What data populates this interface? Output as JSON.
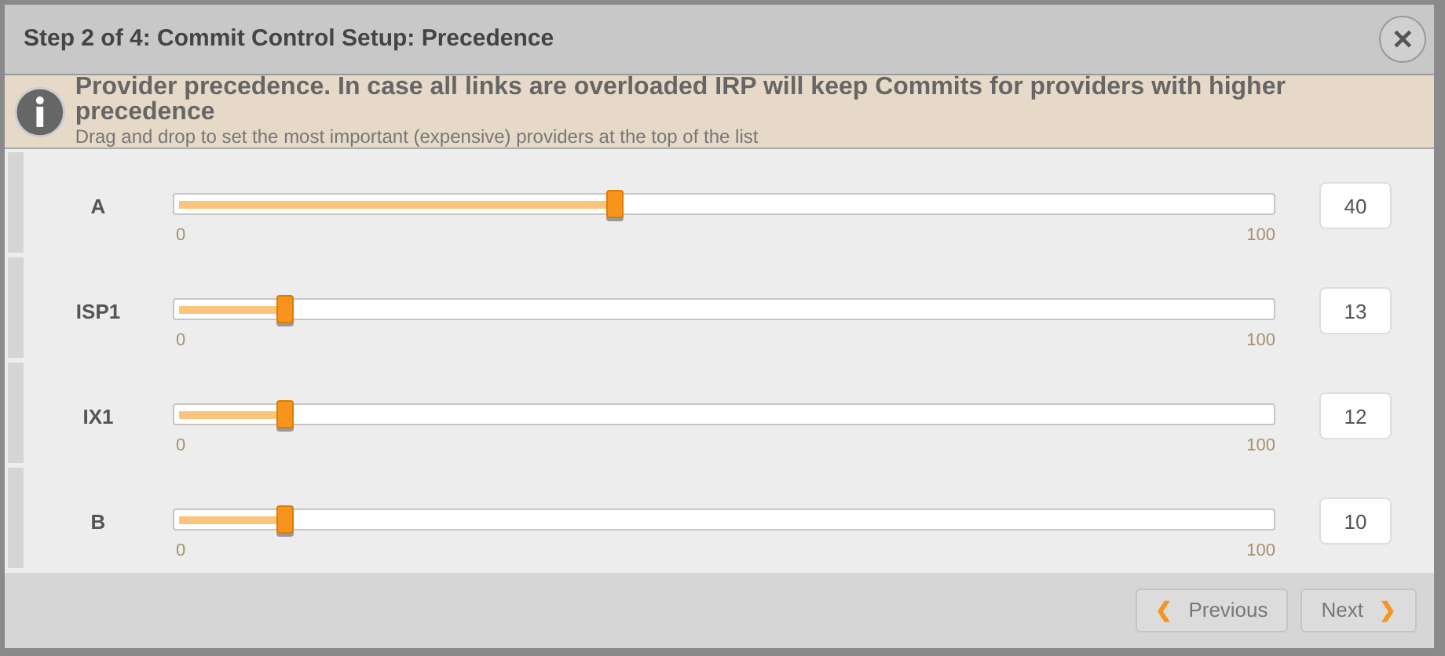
{
  "dialog": {
    "title": "Step 2 of 4: Commit Control Setup: Precedence",
    "close": "✕"
  },
  "info": {
    "heading": "Provider precedence. In case all links are overloaded IRP will keep Commits for providers with higher precedence",
    "text": "Drag and drop to set the most important (expensive) providers at the top of the list"
  },
  "providers": [
    {
      "name": "A",
      "level": 0.4,
      "min": "0",
      "max": "100",
      "value": "40"
    },
    {
      "name": "ISP1",
      "level": 0.1,
      "min": "0",
      "max": "100",
      "value": "13"
    },
    {
      "name": "IX1",
      "level": 0.1,
      "min": "0",
      "max": "100",
      "value": "12"
    },
    {
      "name": "B",
      "level": 0.1,
      "min": "0",
      "max": "100",
      "value": "10"
    }
  ],
  "buttons": [
    {
      "kind": "previous",
      "label": "Previous",
      "arrow": "❮"
    },
    {
      "kind": "next",
      "label": "Next",
      "arrow": "❯"
    }
  ]
}
